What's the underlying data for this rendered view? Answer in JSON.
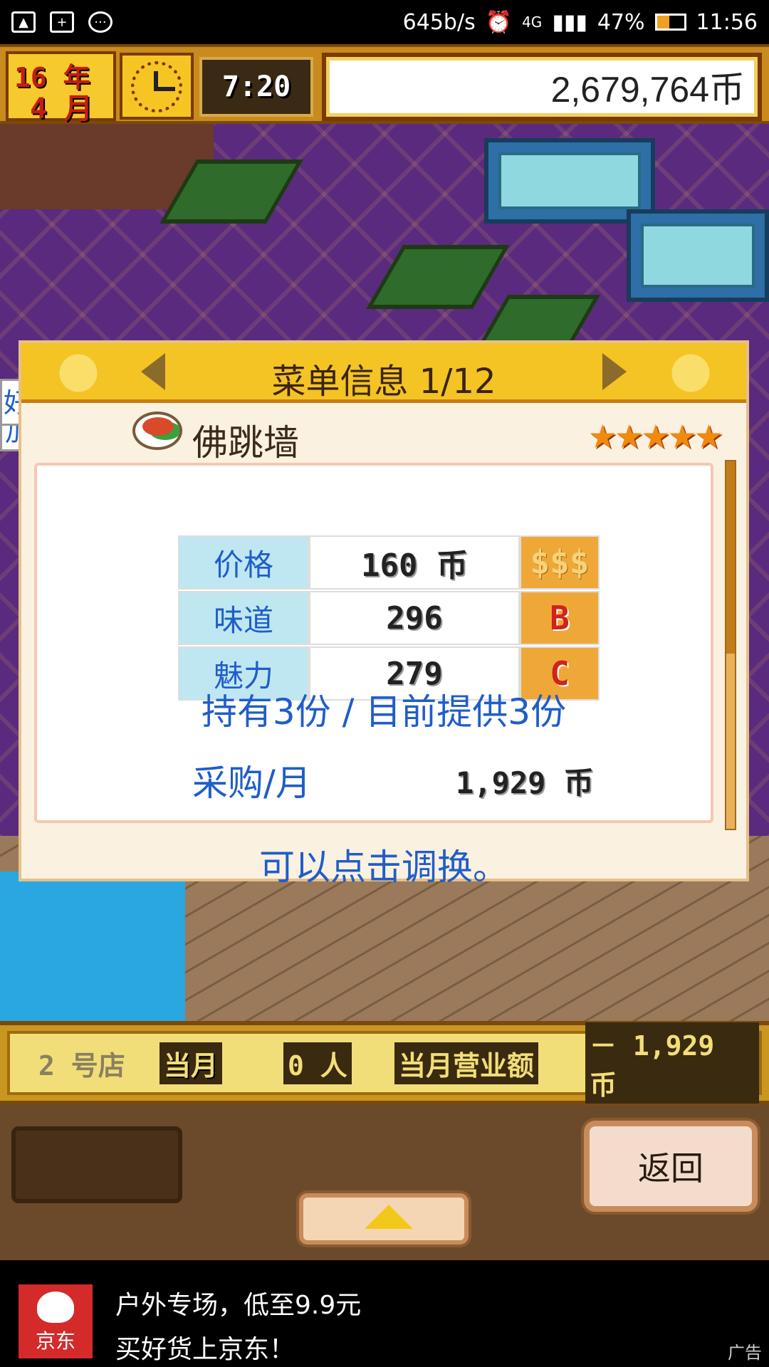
{
  "status_bar": {
    "speed": "645b/s",
    "network": "4G",
    "battery": "47%",
    "time": "11:56"
  },
  "game_top": {
    "year": "16 年",
    "month": "4 月",
    "clock_time": "7:20",
    "money": "2,679,764币"
  },
  "scene": {
    "bubble_1": "好",
    "bubble_2": "加油吧"
  },
  "dialog": {
    "title": "菜单信息 1/12",
    "dish_name": "佛跳墙",
    "stars": "★★★★★",
    "rating_stars": 5,
    "stats": [
      {
        "label": "价格",
        "value": "160 币",
        "grade": "$$$"
      },
      {
        "label": "味道",
        "value": "296",
        "grade": "B"
      },
      {
        "label": "魅力",
        "value": "279",
        "grade": "C"
      }
    ],
    "holding": "持有3份 / 目前提供3份",
    "purchase_label": "采购/月",
    "purchase_value": "1,929 币",
    "hint": "可以点击调换。"
  },
  "info_bar": {
    "store": "2 号店",
    "month_label": "当月",
    "customers": "0 人",
    "sales_label": "当月营业额",
    "sales_value": "－ 1,929 币"
  },
  "buttons": {
    "back": "返回"
  },
  "ad": {
    "logo_text": "京东",
    "line1": "户外专场，低至9.9元",
    "line2": "买好货上京东！",
    "tag": "广告"
  }
}
